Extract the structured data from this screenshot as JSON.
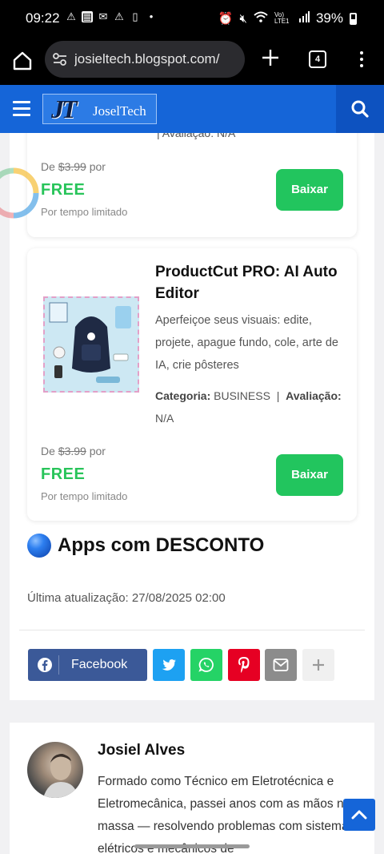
{
  "status_bar": {
    "time": "09:22",
    "battery_pct": "39%",
    "network": "Vo) LTE1"
  },
  "browser": {
    "url": "josieltech.blogspot.com/",
    "tab_count": "4"
  },
  "site": {
    "logo_letters": "JT",
    "logo_name": "JoselTech"
  },
  "top_card": {
    "partial_meta": "| Avaliação: N/A",
    "price_prefix": "De",
    "old_price": "$3.99",
    "price_suffix": "por",
    "free_label": "FREE",
    "limited": "Por tempo limitado",
    "button": "Baixar"
  },
  "product": {
    "title": "ProductCut PRO: AI Auto Editor",
    "description": "Aperfeiçoe seus visuais: edite, projete, apague fundo, cole, arte de IA, crie pôsteres",
    "category_label": "Categoria:",
    "category_value": "BUSINESS",
    "separator": "|",
    "rating_label": "Avaliação:",
    "rating_value": "N/A",
    "price_prefix": "De",
    "old_price": "$3.99",
    "price_suffix": "por",
    "free_label": "FREE",
    "limited": "Por tempo limitado",
    "button": "Baixar"
  },
  "section": {
    "title": "Apps com DESCONTO"
  },
  "last_update": "Última atualização: 27/08/2025 02:00",
  "share": {
    "facebook_label": "Facebook"
  },
  "author": {
    "name": "Josiel Alves",
    "bio": "Formado como Técnico em Eletrotécnica e Eletromecânica, passei anos com as mãos na massa — resolvendo problemas com sistemas elétricos e mecânicos de"
  }
}
